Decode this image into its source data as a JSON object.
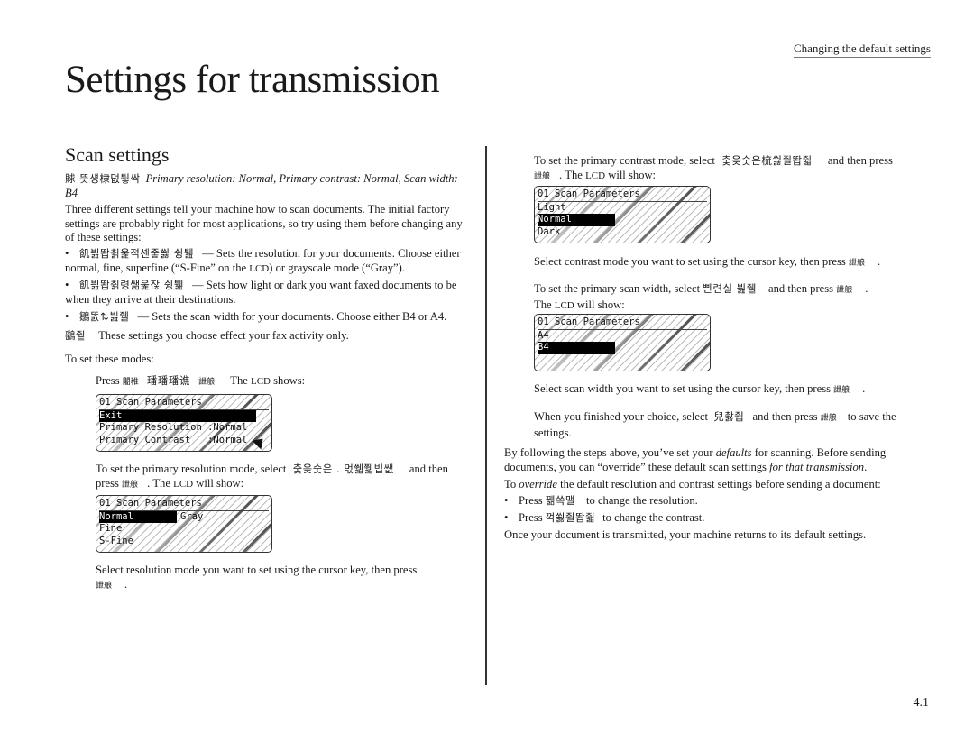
{
  "header": {
    "section_link": "Changing the default settings"
  },
  "page_title": "Settings for transmission",
  "section_title": "Scan settings",
  "defaults_line": {
    "key_glyphs": "賕 뜻섕棣덦퉣싹",
    "text": "Primary resolution: Normal, Primary contrast: Normal, Scan width: B4"
  },
  "intro": "Three different settings tell your machine how to scan documents. The initial factory settings are probably right for most applications, so try using them before changing any of these settings:",
  "bullets": [
    {
      "key": "飢븶똽췱욽젹셴줗쐻 슁퉲",
      "text": "— Sets the resolution for your documents. Choose either normal, fine, superfine (“S-Fine” on the ",
      "lcd": "LCD",
      "text2": ") or grayscale mode (“Gray”)."
    },
    {
      "key": "飢븶똽췱령쌞욽잖 슁퉲",
      "text": "— Sets how light or dark you want faxed documents to be when they arrive at their destinations."
    },
    {
      "key": "鶵똜⇅븶줼",
      "text": "— Sets the scan width for your documents. Choose either B4 or A4."
    }
  ],
  "note": {
    "key": "鷂줱",
    "text": "These settings you choose effect your fax activity only."
  },
  "to_set_modes": "To set these modes:",
  "press_line": {
    "press": "Press",
    "k1": "闍稚",
    "k2": "璠璠璠谯",
    "k3": "詍艆",
    "text": "The",
    "lcd": "LCD",
    "text2": "shows:"
  },
  "lcd_main": {
    "title": "01 Scan Parameters",
    "rows": [
      {
        "label": "Exit",
        "selected": true
      },
      {
        "label": "Primary Resolution :Normal",
        "selected": false
      },
      {
        "label": "Primary Contrast   :Normal",
        "selected": false
      }
    ]
  },
  "resolution_step": {
    "text1": "To set the primary resolution mode, select",
    "key": "춫읒숫은 . 먻쒧쮋빕쌦",
    "text2": "and then press",
    "key2": "詍艆",
    "text3": ". The",
    "lcd": "LCD",
    "text4": "will show:"
  },
  "lcd_resolution": {
    "title": "01 Scan Parameters",
    "rows": [
      {
        "label": "Normal",
        "right": "Gray",
        "selected": true
      },
      {
        "label": "Fine",
        "selected": false
      },
      {
        "label": "S-Fine",
        "selected": false
      }
    ]
  },
  "resolution_select": {
    "text": "Select resolution mode you want to set using the cursor key, then press",
    "key": "詍艆",
    "end": "."
  },
  "contrast_step": {
    "text1": "To set the primary contrast mode, select",
    "key": "춫읒숫은梳쐻쥘똽줣",
    "text2": "and then press",
    "key2": "詍艆",
    "text3": ". The",
    "lcd": "LCD",
    "text4": "will show:"
  },
  "lcd_contrast": {
    "title": "01 Scan Parameters",
    "rows": [
      {
        "label": "Light",
        "selected": false
      },
      {
        "label": "Normal",
        "selected": true
      },
      {
        "label": "Dark",
        "selected": false
      }
    ]
  },
  "contrast_select": {
    "text": "Select contrast mode you want to set using the cursor key, then press",
    "key": "詍艆",
    "end": "."
  },
  "width_step": {
    "text1": "To set the primary scan width, select",
    "key": "쁸련실  븶줼",
    "text2": "and then press",
    "key2": "詍艆",
    "end": ".",
    "text3": "The",
    "lcd": "LCD",
    "text4": "will show:"
  },
  "lcd_width": {
    "title": "01 Scan Parameters",
    "rows": [
      {
        "label": "A4",
        "selected": false
      },
      {
        "label": "B4",
        "selected": true
      }
    ]
  },
  "width_select": {
    "text": "Select scan width you want to set using the cursor key, then press",
    "key": "詍艆",
    "end": "."
  },
  "finish_step": {
    "text1": "When you finished your choice, select",
    "key": "兒촳줩",
    "text2": "and then press",
    "key2": "詍艆",
    "text3": "to save the settings."
  },
  "override_para": {
    "t1": "By following the steps above, you’ve set your ",
    "em1": "defaults",
    "t2": " for scanning. Before sending documents, you can “override” these default scan settings ",
    "em2": "for that transmission",
    "t3": "."
  },
  "override_intro": {
    "t1": "To ",
    "em": "override",
    "t2": " the default resolution and contrast settings before sending a document:"
  },
  "override_bullets": [
    {
      "press": "Press",
      "key": "꿺쓱맬",
      "text": "to change the resolution."
    },
    {
      "press": "Press",
      "key": "꺽쐻쥘똽줣",
      "text": "to change the contrast."
    }
  ],
  "closing": "Once your document is transmitted, your machine returns to its default settings.",
  "page_number": "4.1"
}
